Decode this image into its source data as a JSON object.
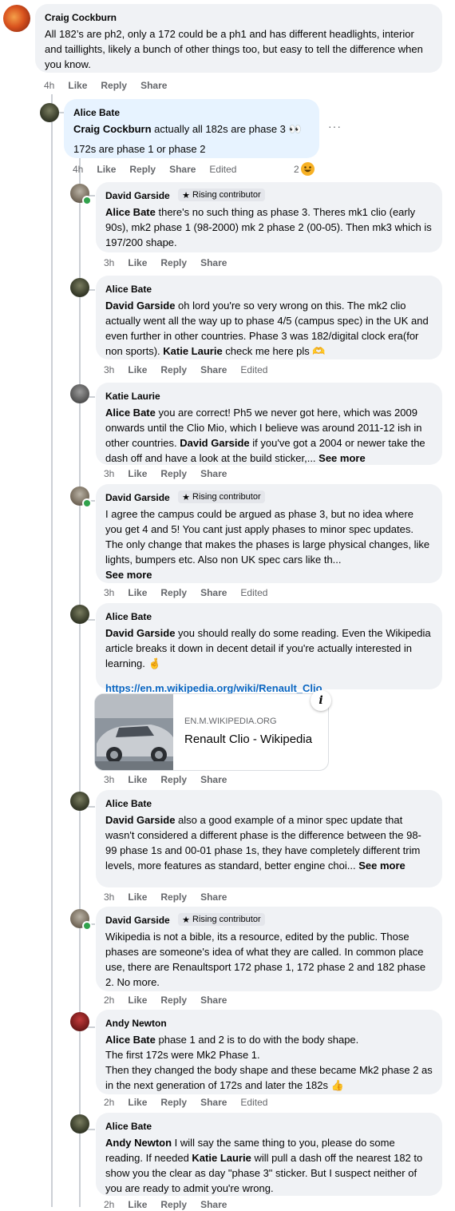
{
  "comments": [
    {
      "author": "Craig Cockburn",
      "text": "All 182’s are ph2, only a 172 could be a ph1 and has different headlights, interior and taillights, likely a bunch of other things too, but easy to tell the difference when you know.",
      "time": "4h",
      "like": "Like",
      "reply": "Reply",
      "share": "Share"
    },
    {
      "author": "Alice Bate",
      "mention": "Craig Cockburn",
      "text1": " actually all 182s are phase 3 👀",
      "text2": "172s are phase 1 or phase 2",
      "time": "4h",
      "like": "Like",
      "reply": "Reply",
      "share": "Share",
      "edited": "Edited",
      "reaction_count": "2",
      "more_menu": "···"
    },
    {
      "author": "David Garside",
      "badge": "Rising contributor",
      "mention": "Alice Bate",
      "text": " there's no such thing as phase 3. Theres mk1 clio (early 90s), mk2 phase 1 (98-2000) mk 2 phase 2 (00-05). Then mk3 which is 197/200 shape.",
      "time": "3h",
      "like": "Like",
      "reply": "Reply",
      "share": "Share"
    },
    {
      "author": "Alice Bate",
      "mention": "David Garside",
      "text": " oh lord you're so very wrong on this. The mk2 clio actually went all the way up to phase 4/5 (campus spec) in the UK and even further in other countries. Phase 3 was 182/digital clock era(for non sports). ",
      "mention2": "Katie Laurie",
      "text_end": " check me here pls 🫶",
      "time": "3h",
      "like": "Like",
      "reply": "Reply",
      "share": "Share",
      "edited": "Edited"
    },
    {
      "author": "Katie Laurie",
      "mention": "Alice Bate",
      "text": " you are correct! Ph5 we never got here, which was 2009 onwards until the Clio Mio, which I believe was around 2011-12 ish in other countries. ",
      "mention2": "David Garside",
      "text_end": " if you've got a 2004 or newer take the dash off and have a look at the build sticker,... ",
      "see_more": "See more",
      "time": "3h",
      "like": "Like",
      "reply": "Reply",
      "share": "Share"
    },
    {
      "author": "David Garside",
      "badge": "Rising contributor",
      "text": "I agree the campus could be argued as phase 3, but no idea where you get 4 and 5! You cant just apply phases to minor spec updates. The only change that makes the phases is large physical changes, like lights, bumpers etc. Also non UK spec cars like th...",
      "see_more": "See more",
      "time": "3h",
      "like": "Like",
      "reply": "Reply",
      "share": "Share",
      "edited": "Edited"
    },
    {
      "author": "Alice Bate",
      "mention": "David Garside",
      "text": " you should really do some reading. Even the Wikipedia article breaks it down in decent detail if you're actually interested in learning. 🤞",
      "link": "https://en.m.wikipedia.org/wiki/Renault_Clio",
      "card_domain": "EN.M.WIKIPEDIA.ORG",
      "card_title": "Renault Clio - Wikipedia",
      "card_info": "i",
      "time": "3h",
      "like": "Like",
      "reply": "Reply",
      "share": "Share"
    },
    {
      "author": "Alice Bate",
      "mention": "David Garside",
      "text": " also a good example of a minor spec update that wasn't considered a different phase is the difference between the 98-99 phase 1s and 00-01 phase 1s, they have completely different trim levels, more features as standard, better engine choi... ",
      "see_more": "See more",
      "time": "3h",
      "like": "Like",
      "reply": "Reply",
      "share": "Share"
    },
    {
      "author": "David Garside",
      "badge": "Rising contributor",
      "text": "Wikipedia is not a bible, its a resource, edited by the public. Those phases are someone's idea of what they are called. In common place use, there are Renaultsport 172 phase 1, 172 phase 2 and 182 phase 2. No more.",
      "time": "2h",
      "like": "Like",
      "reply": "Reply",
      "share": "Share"
    },
    {
      "author": "Andy Newton",
      "mention": "Alice Bate",
      "text": " phase 1 and 2 is to do with the body shape.",
      "line2": "The first 172s were Mk2 Phase 1.",
      "line3": "Then they changed the body shape and these became Mk2 phase 2 as in the next generation of 172s and later the 182s 👍",
      "time": "2h",
      "like": "Like",
      "reply": "Reply",
      "share": "Share",
      "edited": "Edited"
    },
    {
      "author": "Alice Bate",
      "mention": "Andy Newton",
      "text": " I will say the same thing to you, please do some reading. If needed ",
      "mention2": "Katie Laurie",
      "text_end": " will pull a dash off the nearest 182 to show you the clear as day \"phase 3\" sticker. But I suspect neither of you are ready to admit you're wrong.",
      "time": "2h",
      "like": "Like",
      "reply": "Reply",
      "share": "Share"
    }
  ],
  "colors": {
    "bubble": "#f0f2f5",
    "highlight_bubble": "#e7f3ff",
    "link": "#0a66c2",
    "meta": "#65676b",
    "online": "#31a24c"
  }
}
